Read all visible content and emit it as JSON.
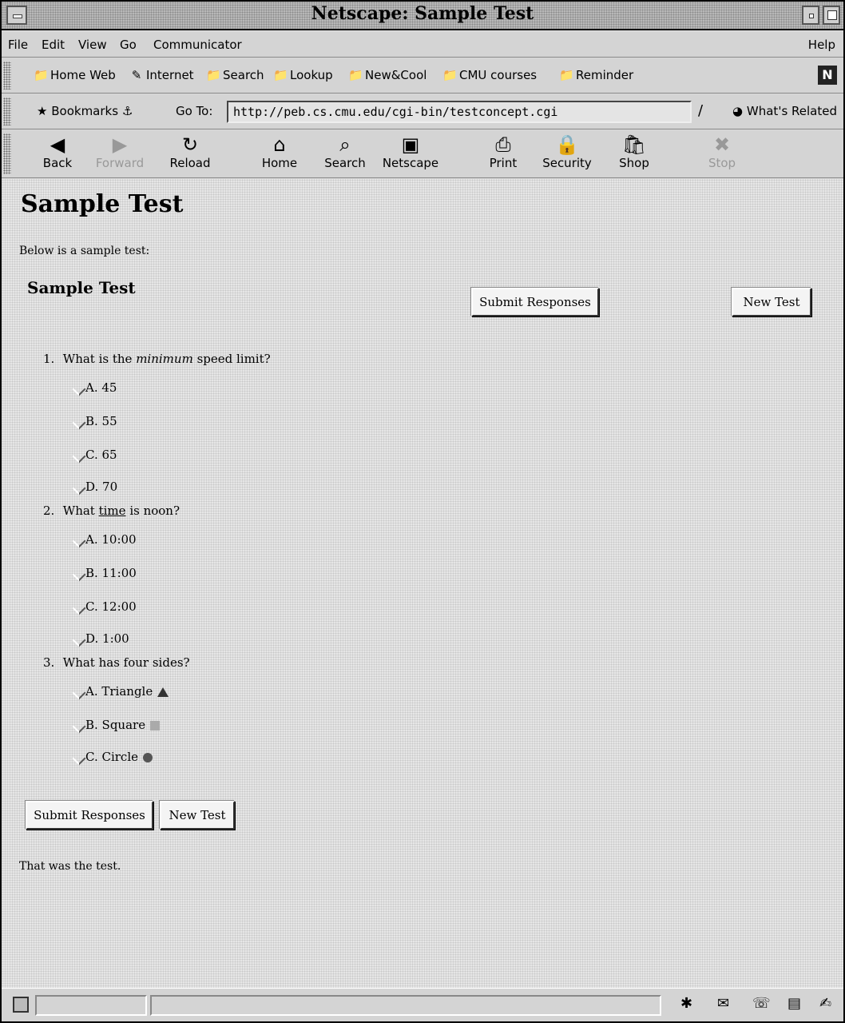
{
  "window": {
    "title": "Netscape: Sample Test"
  },
  "menu": {
    "file": "File",
    "edit": "Edit",
    "view": "View",
    "go": "Go",
    "communicator": "Communicator",
    "help": "Help"
  },
  "personal_toolbar": {
    "links": [
      {
        "label": "Home Web",
        "icon": "folder-icon"
      },
      {
        "label": "Internet",
        "icon": "pen-icon"
      },
      {
        "label": "Search",
        "icon": "folder-icon"
      },
      {
        "label": "Lookup",
        "icon": "folder-icon"
      },
      {
        "label": "New&Cool",
        "icon": "folder-icon"
      },
      {
        "label": "CMU courses",
        "icon": "folder-icon"
      },
      {
        "label": "Reminder",
        "icon": "folder-icon"
      }
    ],
    "logo": "N"
  },
  "location_toolbar": {
    "bookmarks": "Bookmarks",
    "goto_label": "Go To:",
    "url": "http://peb.cs.cmu.edu/cgi-bin/testconcept.cgi",
    "whats_related": "What's Related"
  },
  "nav_toolbar": {
    "back": "Back",
    "forward": "Forward",
    "reload": "Reload",
    "home": "Home",
    "search": "Search",
    "netscape": "Netscape",
    "print": "Print",
    "security": "Security",
    "shop": "Shop",
    "stop": "Stop"
  },
  "page": {
    "heading": "Sample Test",
    "intro": "Below is a sample test:",
    "test_title": "Sample Test",
    "submit_label": "Submit Responses",
    "new_test_label": "New Test",
    "questions": [
      {
        "number": "1.",
        "text_before": "What is the ",
        "emphasis": "minimum",
        "text_after": " speed limit?",
        "options": [
          "A. 45",
          "B. 55",
          "C. 65",
          "D. 70"
        ]
      },
      {
        "number": "2.",
        "text_before": "What ",
        "link": "time",
        "text_after": " is noon?",
        "options": [
          "A. 10:00",
          "B. 11:00",
          "C. 12:00",
          "D. 1:00"
        ]
      },
      {
        "number": "3.",
        "text": "What has four sides?",
        "options": [
          "A. Triangle",
          "B. Square",
          "C. Circle"
        ]
      }
    ],
    "outro": "That was the test."
  }
}
